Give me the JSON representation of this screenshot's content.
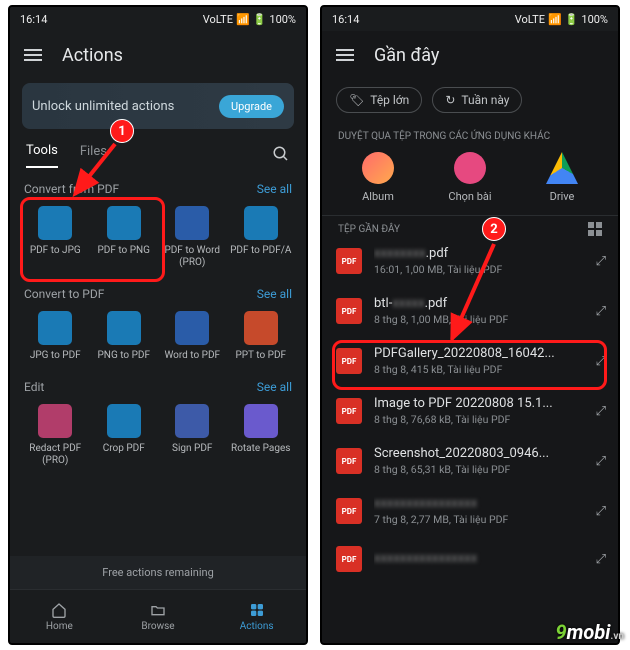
{
  "status": {
    "time": "16:14",
    "battery": "100%",
    "net": "VoLTE"
  },
  "left": {
    "title": "Actions",
    "banner": {
      "text": "Unlock unlimited actions",
      "cta": "Upgrade"
    },
    "tabs": {
      "a": "Tools",
      "b": "Files"
    },
    "seeall": "See all",
    "sections": {
      "convert_from": {
        "title": "Convert from PDF",
        "items": [
          "PDF to JPG",
          "PDF to PNG",
          "PDF to Word (PRO)",
          "PDF to PDF/A"
        ]
      },
      "convert_to": {
        "title": "Convert to PDF",
        "items": [
          "JPG to PDF",
          "PNG to PDF",
          "Word to PDF",
          "PPT to PDF"
        ]
      },
      "edit": {
        "title": "Edit",
        "items": [
          "Redact PDF (PRO)",
          "Crop PDF",
          "Sign PDF",
          "Rotate Pages"
        ]
      }
    },
    "promo": "Free actions remaining",
    "nav": {
      "home": "Home",
      "browse": "Browse",
      "actions": "Actions"
    }
  },
  "right": {
    "title": "Gần đây",
    "chips": {
      "big": "Tệp lớn",
      "week": "Tuần này"
    },
    "browse_label": "DUYỆT QUA TỆP TRONG CÁC ỨNG DỤNG KHÁC",
    "sources": {
      "album": "Album",
      "song": "Chọn bài",
      "drive": "Drive"
    },
    "recent_label": "TỆP GẦN ĐÂY",
    "files": [
      {
        "name_pre": "",
        "name_blur": "xxxxxxxx",
        "name_suf": ".pdf",
        "meta": "16:01, 1,00 MB, Tài liệu PDF"
      },
      {
        "name_pre": "btl-",
        "name_blur": "xxxxx",
        "name_suf": ".pdf",
        "meta": "8 thg 8, 1,00 MB, Tài liệu PDF"
      },
      {
        "name_pre": "PDFGallery_20220808_16042...",
        "name_blur": "",
        "name_suf": "",
        "meta": "8 thg 8, 415 kB, Tài liệu PDF"
      },
      {
        "name_pre": "Image to PDF 20220808 15.1...",
        "name_blur": "",
        "name_suf": "",
        "meta": "8 thg 8, 76,68 kB, Tài liệu PDF"
      },
      {
        "name_pre": "Screenshot_20220803_0946...",
        "name_blur": "",
        "name_suf": "",
        "meta": "8 thg 8, 65,31 kB, Tài liệu PDF"
      },
      {
        "name_pre": "",
        "name_blur": "xxxxxxxxxxxxxxxx",
        "name_suf": "",
        "meta": "7 thg 8, 2,77 MB, Tài liệu PDF"
      },
      {
        "name_pre": "",
        "name_blur": "xxxxxxxxxxxxxxxx",
        "name_suf": "",
        "meta": ""
      }
    ]
  },
  "watermark": "9mobi",
  "watermark_vn": ".vn"
}
